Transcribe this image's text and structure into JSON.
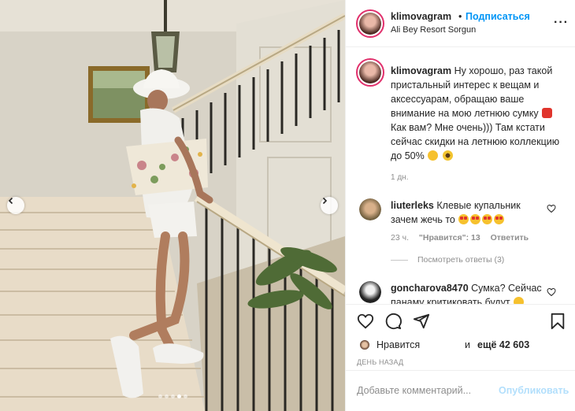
{
  "header": {
    "username": "klimovagram",
    "separator": "•",
    "follow_label": "Подписаться",
    "location": "Ali Bey Resort Sorgun",
    "more_icon": "more-horizontal-icon"
  },
  "caption": {
    "username": "klimovagram",
    "text_part1": "Ну хорошо, раз такой пристальный интерес к вещам и аксессуарам, обращаю ваше внимание на мою летнюю сумку",
    "text_part2": "Как вам? Мне очень))) Там кстати сейчас скидки на летнюю коллекцию до 50%",
    "time": "1 дн."
  },
  "comments": [
    {
      "username": "liuterleks",
      "text": "Клевые купальник зачем жечь то",
      "time": "23 ч.",
      "likes": "\"Нравится\": 13",
      "reply_label": "Ответить",
      "view_replies": "Посмотреть ответы (3)"
    },
    {
      "username": "goncharova8470",
      "text": "Сумка? Сейчас панаму критиковать будут"
    }
  ],
  "actions": {
    "like_icon": "heart-icon",
    "comment_icon": "comment-icon",
    "share_icon": "share-icon",
    "save_icon": "bookmark-icon",
    "likes_label": "Нравится",
    "likes_and": "и",
    "likes_count": "ещё 42 603",
    "posted": "ДЕНЬ НАЗАД"
  },
  "add_comment": {
    "placeholder": "Добавьте комментарий...",
    "publish_label": "Опубликовать"
  },
  "carousel": {
    "prev_icon": "chevron-left-icon",
    "next_icon": "chevron-right-icon",
    "dots": 5,
    "active_index": 3
  },
  "colors": {
    "accent": "#0095f6",
    "publish_disabled": "#b2dffc",
    "muted": "#8e8e8e"
  }
}
